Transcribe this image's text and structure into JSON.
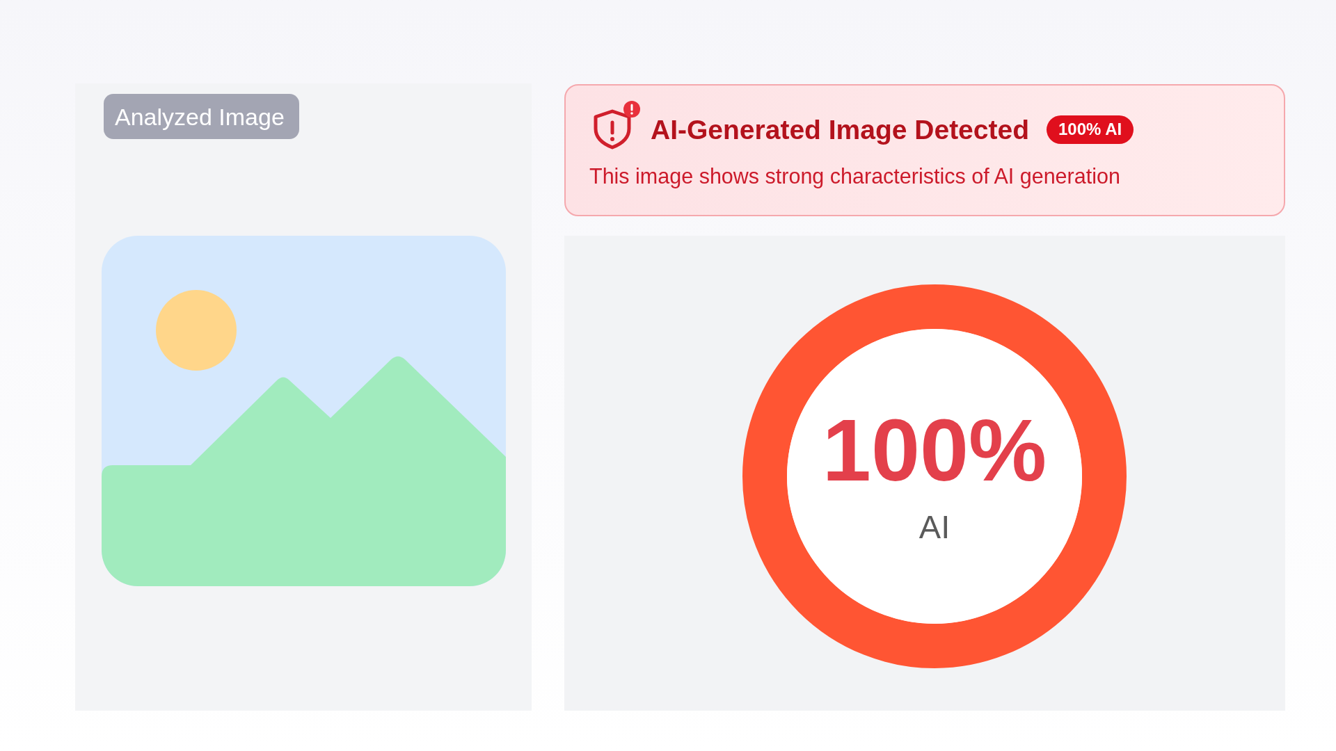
{
  "image_panel": {
    "label": "Analyzed Image"
  },
  "alert": {
    "title": "AI-Generated Image Detected",
    "badge": "100% AI",
    "message": "This image shows strong characteristics of AI generation"
  },
  "gauge": {
    "level": 1,
    "value": "100%",
    "caption": "AI"
  }
}
